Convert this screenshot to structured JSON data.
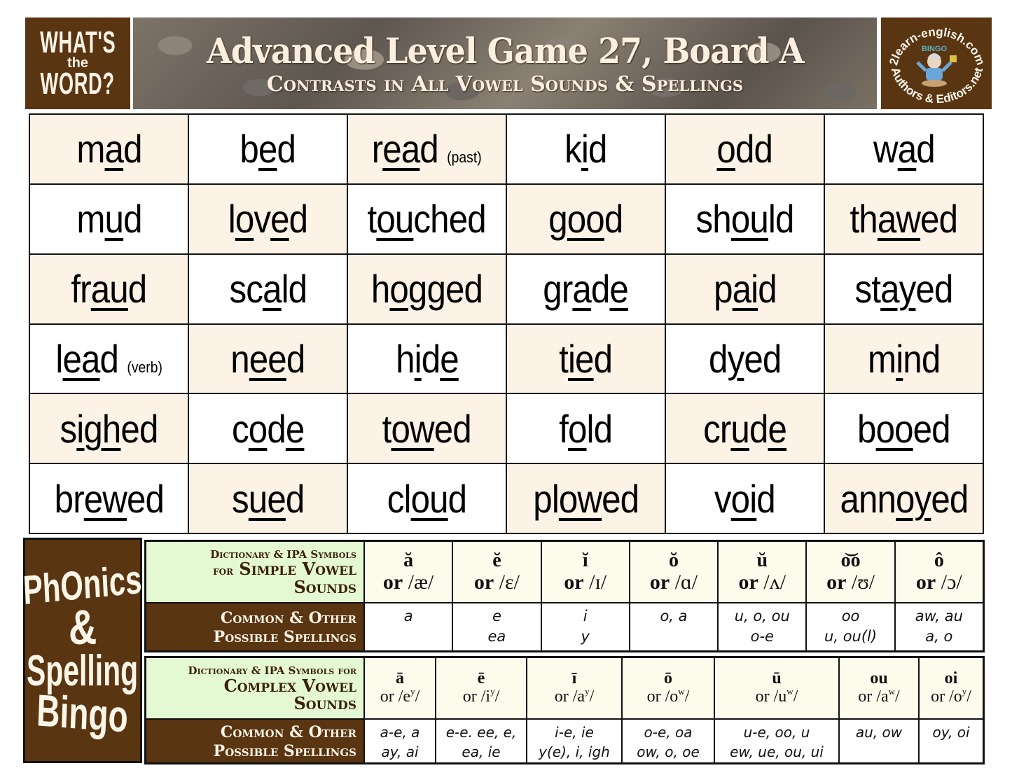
{
  "header": {
    "logo_left": {
      "line1": "WHAT'S",
      "line2": "the",
      "line3": "WORD?"
    },
    "title": "Advanced Level Game 27, Board A",
    "subtitle": "Contrasts in All Vowel Sounds & Spellings",
    "logo_right": {
      "top_text": "2learn-english.com",
      "center_text": "BINGO",
      "bottom_text": "Authors & Editors.net"
    }
  },
  "board": {
    "rows": [
      [
        {
          "pre": "m",
          "u": "a",
          "post": "d",
          "note": "",
          "hl": true
        },
        {
          "pre": "b",
          "u": "e",
          "post": "d",
          "note": "",
          "hl": false
        },
        {
          "pre": "r",
          "u": "ea",
          "post": "d",
          "note": "(past)",
          "hl": true
        },
        {
          "pre": "k",
          "u": "i",
          "post": "d",
          "note": "",
          "hl": false
        },
        {
          "pre": "",
          "u": "o",
          "post": "dd",
          "note": "",
          "hl": true
        },
        {
          "pre": "w",
          "u": "a",
          "post": "d",
          "note": "",
          "hl": false
        }
      ],
      [
        {
          "pre": "m",
          "u": "u",
          "post": "d",
          "note": "",
          "hl": false
        },
        {
          "pre": "l",
          "u": "o",
          "mid": "v",
          "u2": "e",
          "post": "d",
          "note": "",
          "hl": true
        },
        {
          "pre": "t",
          "u": "ou",
          "post": "ched",
          "note": "",
          "hl": false
        },
        {
          "pre": "g",
          "u": "oo",
          "post": "d",
          "note": "",
          "hl": true
        },
        {
          "pre": "sh",
          "u": "ou",
          "post": "ld",
          "note": "",
          "hl": false
        },
        {
          "pre": "th",
          "u": "aw",
          "post": "ed",
          "note": "",
          "hl": true
        }
      ],
      [
        {
          "pre": "fr",
          "u": "au",
          "post": "d",
          "note": "",
          "hl": true
        },
        {
          "pre": "sc",
          "u": "a",
          "post": "ld",
          "note": "",
          "hl": false
        },
        {
          "pre": "h",
          "u": "o",
          "post": "gged",
          "note": "",
          "hl": true
        },
        {
          "pre": "gr",
          "u": "a",
          "mid": "d",
          "u2": "e",
          "post": "",
          "note": "",
          "hl": false
        },
        {
          "pre": "p",
          "u": "ai",
          "post": "d",
          "note": "",
          "hl": true
        },
        {
          "pre": "st",
          "u": "ay",
          "post": "ed",
          "note": "",
          "hl": false
        }
      ],
      [
        {
          "pre": "l",
          "u": "ea",
          "post": "d",
          "note": "(verb)",
          "hl": false
        },
        {
          "pre": "n",
          "u": "ee",
          "post": "d",
          "note": "",
          "hl": true
        },
        {
          "pre": "h",
          "u": "i",
          "mid": "d",
          "u2": "e",
          "post": "",
          "note": "",
          "hl": false
        },
        {
          "pre": "t",
          "u": "ie",
          "post": "d",
          "note": "",
          "hl": true
        },
        {
          "pre": "d",
          "u": "y",
          "post": "ed",
          "note": "",
          "hl": false
        },
        {
          "pre": "m",
          "u": "i",
          "post": "nd",
          "note": "",
          "hl": true
        }
      ],
      [
        {
          "pre": "s",
          "u": "igh",
          "post": "ed",
          "note": "",
          "hl": true
        },
        {
          "pre": "c",
          "u": "o",
          "mid": "d",
          "u2": "e",
          "post": "",
          "note": "",
          "hl": false
        },
        {
          "pre": "t",
          "u": "ow",
          "post": "ed",
          "note": "",
          "hl": true
        },
        {
          "pre": "f",
          "u": "o",
          "post": "ld",
          "note": "",
          "hl": false
        },
        {
          "pre": "cr",
          "u": "u",
          "mid": "d",
          "u2": "e",
          "post": "",
          "note": "",
          "hl": true
        },
        {
          "pre": "b",
          "u": "oo",
          "post": "ed",
          "note": "",
          "hl": false
        }
      ],
      [
        {
          "pre": "br",
          "u": "ew",
          "post": "ed",
          "note": "",
          "hl": false
        },
        {
          "pre": "s",
          "u": "ue",
          "post": "d",
          "note": "",
          "hl": true
        },
        {
          "pre": "cl",
          "u": "ou",
          "post": "d",
          "note": "",
          "hl": false
        },
        {
          "pre": "pl",
          "u": "ow",
          "post": "ed",
          "note": "",
          "hl": true
        },
        {
          "pre": "v",
          "u": "oi",
          "post": "d",
          "note": "",
          "hl": false
        },
        {
          "pre": "ann",
          "u": "oy",
          "post": "ed",
          "note": "",
          "hl": true
        }
      ]
    ]
  },
  "side_logo": {
    "line1": "PhOnics",
    "line2": "&",
    "line3": "Spelling",
    "line4": "Bingo"
  },
  "simple_table": {
    "label_symbols": {
      "line1": "Dictionary & IPA Symbols",
      "line2a": "for",
      "line2b": "Simple Vowel",
      "line3": "Sounds"
    },
    "label_spellings": {
      "line1": "Common & Other",
      "line2": "Possible Spellings"
    },
    "columns": [
      {
        "dict": "ă",
        "ipa": "/æ/",
        "spell1": "a",
        "spell2": ""
      },
      {
        "dict": "ĕ",
        "ipa": "/ɛ/",
        "spell1": "e",
        "spell2": "ea"
      },
      {
        "dict": "ĭ",
        "ipa": "/ɪ/",
        "spell1": "i",
        "spell2": "y"
      },
      {
        "dict": "ŏ",
        "ipa": "/ɑ/",
        "spell1": "o, a",
        "spell2": ""
      },
      {
        "dict": "ŭ",
        "ipa": "/ʌ/",
        "spell1": "u, o, ou",
        "spell2": "o-e"
      },
      {
        "dict": "o͝o",
        "ipa": "/ʊ/",
        "spell1": "oo",
        "spell2": "u, ou(l)"
      },
      {
        "dict": "ô",
        "ipa": "/ɔ/",
        "spell1": "aw, au",
        "spell2": "a, o"
      }
    ],
    "or_word": "or"
  },
  "complex_table": {
    "label_symbols": {
      "line1": "Dictionary & IPA Symbols for",
      "line2": "Complex Vowel",
      "line3": "Sounds"
    },
    "label_spellings": {
      "line1": "Common & Other",
      "line2": "Possible Spellings"
    },
    "columns": [
      {
        "dict": "ā",
        "ipa_base": "/e",
        "ipa_sup": "y",
        "spell1": "a-e, a",
        "spell2": "ay, ai"
      },
      {
        "dict": "ē",
        "ipa_base": "/i",
        "ipa_sup": "y",
        "spell1": "e-e. ee, e,",
        "spell2": "ea, ie"
      },
      {
        "dict": "ī",
        "ipa_base": "/a",
        "ipa_sup": "y",
        "spell1": "i-e, ie",
        "spell2": "y(e), i, igh"
      },
      {
        "dict": "ō",
        "ipa_base": "/o",
        "ipa_sup": "w",
        "spell1": "o-e, oa",
        "spell2": "ow, o, oe"
      },
      {
        "dict": "ū",
        "ipa_base": "/u",
        "ipa_sup": "w",
        "spell1": "u-e, oo, u",
        "spell2": "ew, ue, ou, ui"
      },
      {
        "dict": "ou",
        "ipa_base": "/a",
        "ipa_sup": "w",
        "spell1": "au, ow",
        "spell2": ""
      },
      {
        "dict": "oi",
        "ipa_base": "/o",
        "ipa_sup": "y",
        "spell1": "oy, oi",
        "spell2": ""
      }
    ],
    "or_word": "or"
  },
  "colors": {
    "brown": "#5a3512",
    "cream_cell": "#fcf3e6",
    "green_label": "#e4f8d4",
    "symbol_cell": "#fcfbec"
  }
}
